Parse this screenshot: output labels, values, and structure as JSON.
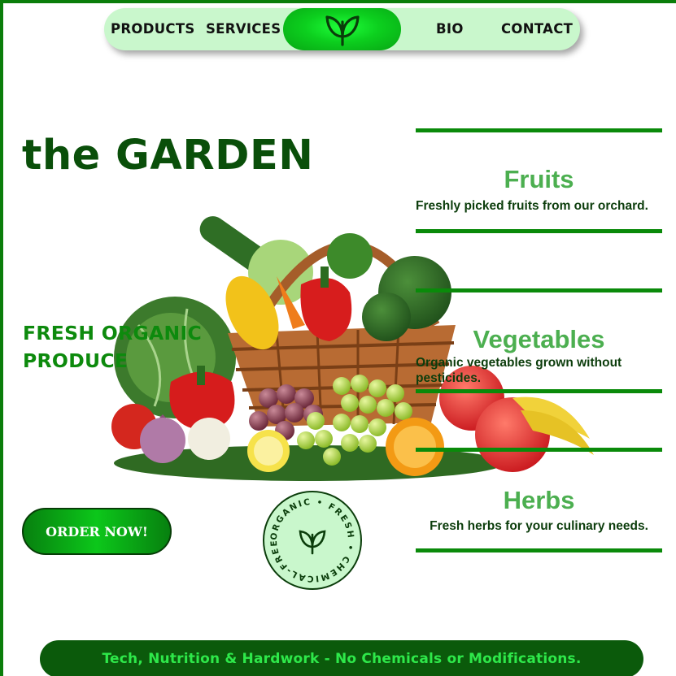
{
  "nav": {
    "items": [
      "PRODUCTS",
      "SERVICES",
      "BIO",
      "CONTACT"
    ],
    "logo_icon": "leaf-sprout-icon"
  },
  "hero": {
    "title": "the GARDEN",
    "subtitle_line1": "FRESH ORGANIC",
    "subtitle_line2": "PRODUCE",
    "image": "fruit-and-vegetable-basket"
  },
  "order_button": {
    "label": "ORDER NOW!"
  },
  "badge": {
    "text": "ORGANIC • FRESH • CHEMICAL-FREE •",
    "icon": "leaf-sprout-icon"
  },
  "cards": [
    {
      "title": "Fruits",
      "description": "Freshly picked fruits from our orchard."
    },
    {
      "title": "Vegetables",
      "description": "Organic vegetables grown without pesticides."
    },
    {
      "title": "Herbs",
      "description": "Fresh herbs for your culinary needs."
    }
  ],
  "footer": {
    "text": "Tech, Nutrition & Hardwork - No Chemicals or Modifications."
  },
  "colors": {
    "accent_green": "#0ccf1e",
    "dark_green": "#0a4f0a",
    "nav_bg": "#c9f7cc",
    "footer_bg": "#0b5a0b",
    "footer_text": "#2ee84a",
    "card_title": "#4caf50"
  }
}
